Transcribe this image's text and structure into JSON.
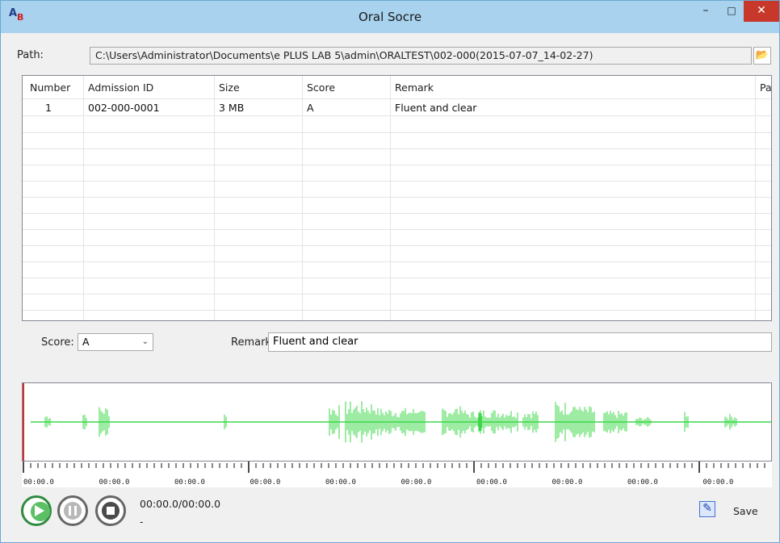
{
  "window": {
    "title": "Oral Socre",
    "minimize": "–",
    "maximize": "□",
    "close": "✕",
    "icon_letters": "A"
  },
  "path": {
    "label": "Path:",
    "value": "C:\\Users\\Administrator\\Documents\\e PLUS LAB 5\\admin\\ORALTEST\\002-000(2015-07-07_14-02-27)"
  },
  "table": {
    "columns": [
      "Number",
      "Admission ID",
      "Size",
      "Score",
      "Remark",
      "Pa"
    ],
    "rows": [
      {
        "number": "1",
        "admission_id": "002-000-0001",
        "size": "3 MB",
        "score": "A",
        "remark": "Fluent and clear"
      }
    ]
  },
  "score": {
    "label": "Score:",
    "value": "A"
  },
  "remark": {
    "label": "Remark",
    "value": "Fluent and clear"
  },
  "waveform": {
    "color": "#3cd84a",
    "cursor_color": "#d03030"
  },
  "ruler": {
    "tick_labels": [
      "00:00.0",
      "00:00.0",
      "00:00.0",
      "00:00.0",
      "00:00.0",
      "00:00.0",
      "00:00.0",
      "00:00.0",
      "00:00.0",
      "00:00.0"
    ]
  },
  "controls": {
    "play": "play-icon",
    "pause": "pause-icon",
    "stop": "stop-icon",
    "time": "00:00.0/00:00.0",
    "dash": "-"
  },
  "save": {
    "label": "Save",
    "icon": "edit-save-icon"
  }
}
